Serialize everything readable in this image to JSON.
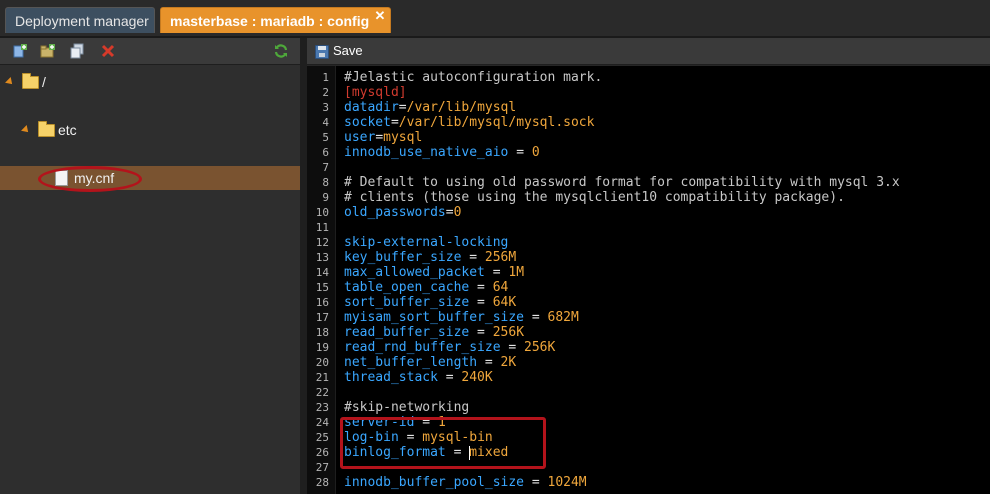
{
  "tabs": [
    {
      "label": "Deployment manager",
      "active": false
    },
    {
      "label": "masterbase : mariadb : config",
      "active": true
    }
  ],
  "tab_close_icon": "✕",
  "left_toolbar_icons": [
    "add-file-icon",
    "add-folder-icon",
    "copy-icon",
    "delete-icon",
    "refresh-icon"
  ],
  "tree": {
    "root": "/",
    "folder": "etc",
    "file": "my.cnf"
  },
  "editor_toolbar": {
    "save_label": "Save"
  },
  "colors": {
    "active_tab": "#e8932b",
    "key": "#3aa7ff",
    "value": "#f0a73c",
    "section": "#d13b2f",
    "highlight": "#b3131b",
    "selected_row": "#7a5330"
  },
  "lines": [
    {
      "n": "1",
      "parts": [
        {
          "t": "#Jelastic autoconfiguration mark.",
          "c": "c"
        }
      ]
    },
    {
      "n": "2",
      "parts": [
        {
          "t": "[mysqld]",
          "c": "sec"
        }
      ]
    },
    {
      "n": "3",
      "parts": [
        {
          "t": "datadir",
          "c": "k"
        },
        {
          "t": "=",
          "c": "op"
        },
        {
          "t": "/var/lib/mysql",
          "c": "v"
        }
      ]
    },
    {
      "n": "4",
      "parts": [
        {
          "t": "socket",
          "c": "k"
        },
        {
          "t": "=",
          "c": "op"
        },
        {
          "t": "/var/lib/mysql/mysql.sock",
          "c": "v"
        }
      ]
    },
    {
      "n": "5",
      "parts": [
        {
          "t": "user",
          "c": "k"
        },
        {
          "t": "=",
          "c": "op"
        },
        {
          "t": "mysql",
          "c": "v"
        }
      ]
    },
    {
      "n": "6",
      "parts": [
        {
          "t": "innodb_use_native_aio",
          "c": "k"
        },
        {
          "t": " = ",
          "c": "op"
        },
        {
          "t": "0",
          "c": "v"
        }
      ]
    },
    {
      "n": "7",
      "parts": []
    },
    {
      "n": "8",
      "parts": [
        {
          "t": "# Default to using old password format for compatibility with mysql 3.x",
          "c": "c"
        }
      ]
    },
    {
      "n": "9",
      "parts": [
        {
          "t": "# clients (those using the mysqlclient10 compatibility package).",
          "c": "c"
        }
      ]
    },
    {
      "n": "10",
      "parts": [
        {
          "t": "old_passwords",
          "c": "k"
        },
        {
          "t": "=",
          "c": "op"
        },
        {
          "t": "0",
          "c": "v"
        }
      ]
    },
    {
      "n": "11",
      "parts": []
    },
    {
      "n": "12",
      "parts": [
        {
          "t": "skip-external-locking",
          "c": "k"
        }
      ]
    },
    {
      "n": "13",
      "parts": [
        {
          "t": "key_buffer_size",
          "c": "k"
        },
        {
          "t": " = ",
          "c": "op"
        },
        {
          "t": "256M",
          "c": "v"
        }
      ]
    },
    {
      "n": "14",
      "parts": [
        {
          "t": "max_allowed_packet",
          "c": "k"
        },
        {
          "t": " = ",
          "c": "op"
        },
        {
          "t": "1M",
          "c": "v"
        }
      ]
    },
    {
      "n": "15",
      "parts": [
        {
          "t": "table_open_cache",
          "c": "k"
        },
        {
          "t": " = ",
          "c": "op"
        },
        {
          "t": "64",
          "c": "v"
        }
      ]
    },
    {
      "n": "16",
      "parts": [
        {
          "t": "sort_buffer_size",
          "c": "k"
        },
        {
          "t": " = ",
          "c": "op"
        },
        {
          "t": "64K",
          "c": "v"
        }
      ]
    },
    {
      "n": "17",
      "parts": [
        {
          "t": "myisam_sort_buffer_size",
          "c": "k"
        },
        {
          "t": " = ",
          "c": "op"
        },
        {
          "t": "682M",
          "c": "v"
        }
      ]
    },
    {
      "n": "18",
      "parts": [
        {
          "t": "read_buffer_size",
          "c": "k"
        },
        {
          "t": " = ",
          "c": "op"
        },
        {
          "t": "256K",
          "c": "v"
        }
      ]
    },
    {
      "n": "19",
      "parts": [
        {
          "t": "read_rnd_buffer_size",
          "c": "k"
        },
        {
          "t": " = ",
          "c": "op"
        },
        {
          "t": "256K",
          "c": "v"
        }
      ]
    },
    {
      "n": "20",
      "parts": [
        {
          "t": "net_buffer_length",
          "c": "k"
        },
        {
          "t": " = ",
          "c": "op"
        },
        {
          "t": "2K",
          "c": "v"
        }
      ]
    },
    {
      "n": "21",
      "parts": [
        {
          "t": "thread_stack",
          "c": "k"
        },
        {
          "t": " = ",
          "c": "op"
        },
        {
          "t": "240K",
          "c": "v"
        }
      ]
    },
    {
      "n": "22",
      "parts": []
    },
    {
      "n": "23",
      "parts": [
        {
          "t": "#skip-networking",
          "c": "c"
        }
      ]
    },
    {
      "n": "24",
      "parts": [
        {
          "t": "server-id",
          "c": "k"
        },
        {
          "t": " = ",
          "c": "op"
        },
        {
          "t": "1",
          "c": "v"
        }
      ]
    },
    {
      "n": "25",
      "parts": [
        {
          "t": "log-bin",
          "c": "k"
        },
        {
          "t": " = ",
          "c": "op"
        },
        {
          "t": "mysql-bin",
          "c": "v"
        }
      ]
    },
    {
      "n": "26",
      "parts": [
        {
          "t": "binlog_format",
          "c": "k"
        },
        {
          "t": " = ",
          "c": "op"
        },
        {
          "t": "|",
          "c": "cursor"
        },
        {
          "t": "mixed",
          "c": "v"
        }
      ]
    },
    {
      "n": "27",
      "parts": []
    },
    {
      "n": "28",
      "parts": [
        {
          "t": "innodb_buffer_pool_size",
          "c": "k"
        },
        {
          "t": " = ",
          "c": "op"
        },
        {
          "t": "1024M",
          "c": "v"
        }
      ]
    }
  ]
}
